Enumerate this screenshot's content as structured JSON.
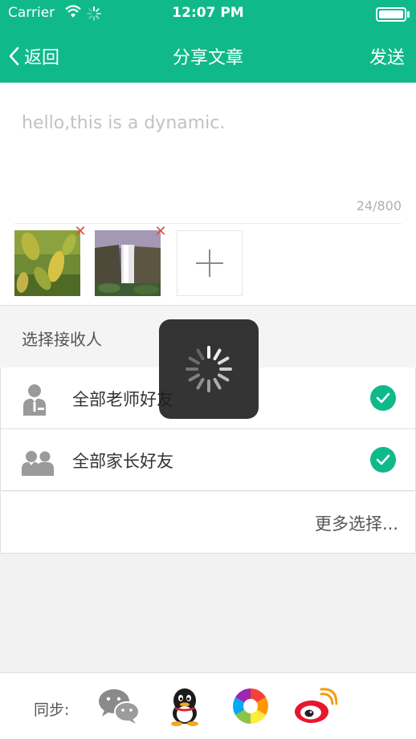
{
  "status_bar": {
    "carrier": "Carrier",
    "time": "12:07 PM"
  },
  "nav": {
    "back_label": "返回",
    "title": "分享文章",
    "send_label": "发送"
  },
  "compose": {
    "placeholder": "hello,this is a dynamic.",
    "counter": "24/800"
  },
  "attachments": [
    {
      "name": "leaves-photo"
    },
    {
      "name": "waterfall-photo"
    }
  ],
  "recipients": {
    "header": "选择接收人",
    "items": [
      {
        "label": "全部老师好友",
        "icon": "teacher-icon",
        "checked": true
      },
      {
        "label": "全部家长好友",
        "icon": "parents-icon",
        "checked": true
      }
    ],
    "more_label": "更多选择..."
  },
  "sync": {
    "label": "同步:",
    "targets": [
      "wechat-icon",
      "qq-icon",
      "moments-icon",
      "weibo-icon"
    ]
  },
  "colors": {
    "primary": "#10b98a",
    "delete": "#e04b4b"
  }
}
